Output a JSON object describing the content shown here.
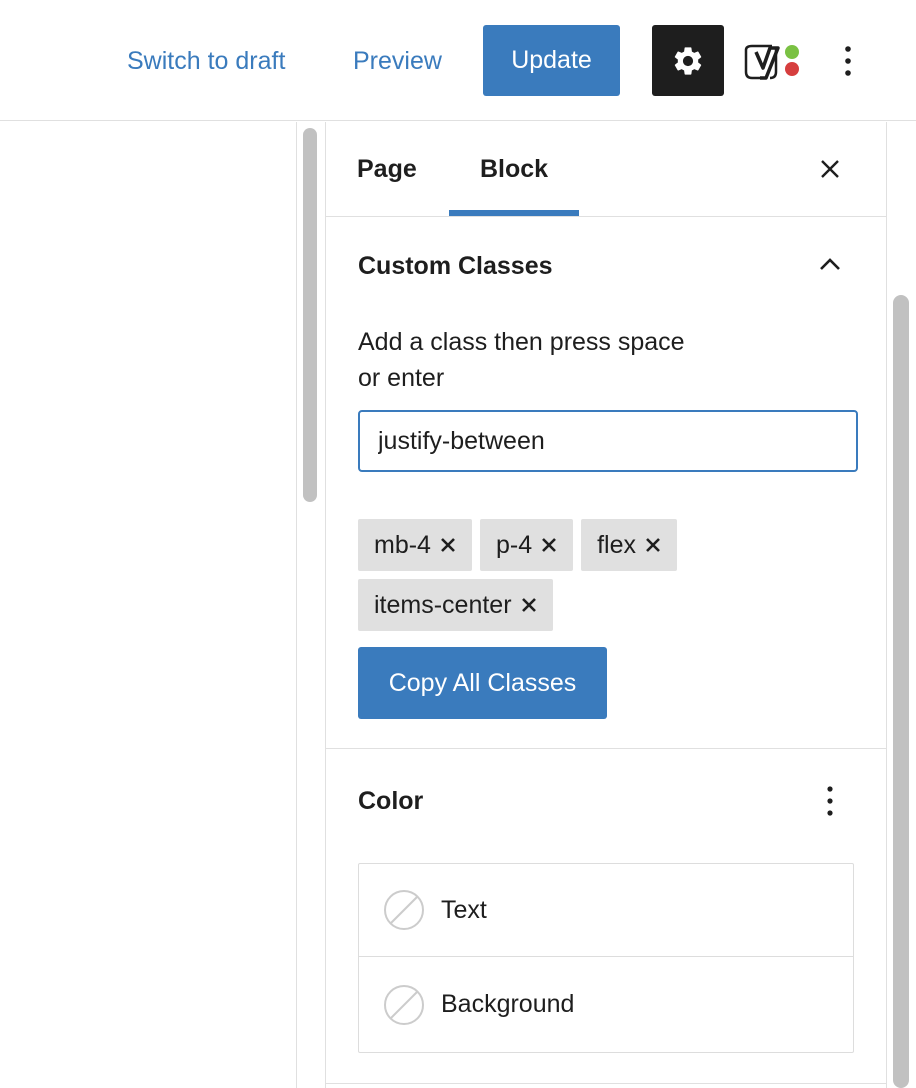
{
  "header": {
    "switch_to_draft": "Switch to draft",
    "preview": "Preview",
    "update": "Update",
    "settings_icon": "gear-icon",
    "yoast_icon": "yoast-seo-icon",
    "more_icon": "vertical-ellipsis-icon"
  },
  "sidebar": {
    "tabs": [
      {
        "label": "Page",
        "active": false
      },
      {
        "label": "Block",
        "active": true
      }
    ],
    "close_icon": "close-icon",
    "custom_classes": {
      "title": "Custom Classes",
      "toggle_icon": "chevron-up-icon",
      "help_text_line1": "Add a class then press space",
      "help_text_line2": "or enter",
      "input_value": "justify-between",
      "classes": [
        "mb-4",
        "p-4",
        "flex",
        "items-center"
      ],
      "copy_button": "Copy All Classes"
    },
    "color": {
      "title": "Color",
      "menu_icon": "vertical-ellipsis-icon",
      "items": [
        {
          "label": "Text",
          "icon": "no-color-swatch-icon"
        },
        {
          "label": "Background",
          "icon": "no-color-swatch-icon"
        }
      ]
    }
  },
  "colors": {
    "accent": "#3a7bbd",
    "dark": "#1e1e1e",
    "chip_bg": "#e0e0e0",
    "yoast_green": "#7ac143",
    "yoast_red": "#d63e3e"
  }
}
